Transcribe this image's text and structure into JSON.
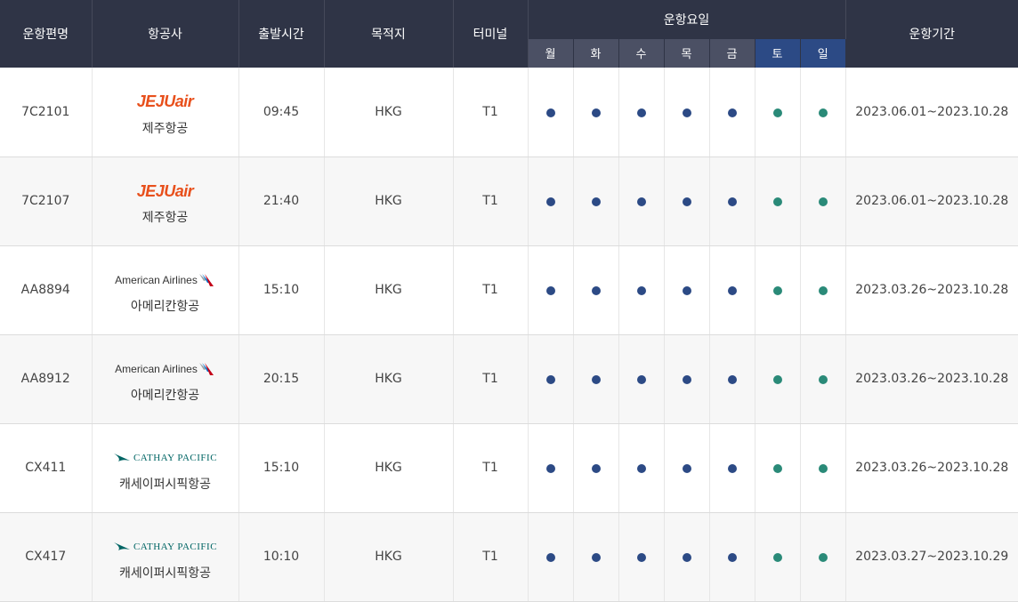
{
  "header": {
    "flight": "운항편명",
    "airline": "항공사",
    "departure": "출발시간",
    "destination": "목적지",
    "terminal": "터미널",
    "days_title": "운항요일",
    "days": [
      "월",
      "화",
      "수",
      "목",
      "금",
      "토",
      "일"
    ],
    "period": "운항기간"
  },
  "colors": {
    "header_bg": "#2f3446",
    "weekday_dot": "#2c4a85",
    "weekend_dot": "#2a8a78",
    "jeju_brand": "#e8501c"
  },
  "rows": [
    {
      "flight": "7C2101",
      "logo": "JEJUair",
      "logo_type": "jeju",
      "airline": "제주항공",
      "time": "09:45",
      "dest": "HKG",
      "terminal": "T1",
      "period": "2023.06.01~2023.10.28"
    },
    {
      "flight": "7C2107",
      "logo": "JEJUair",
      "logo_type": "jeju",
      "airline": "제주항공",
      "time": "21:40",
      "dest": "HKG",
      "terminal": "T1",
      "period": "2023.06.01~2023.10.28"
    },
    {
      "flight": "AA8894",
      "logo": "American Airlines",
      "logo_type": "aa",
      "airline": "아메리칸항공",
      "time": "15:10",
      "dest": "HKG",
      "terminal": "T1",
      "period": "2023.03.26~2023.10.28"
    },
    {
      "flight": "AA8912",
      "logo": "American Airlines",
      "logo_type": "aa",
      "airline": "아메리칸항공",
      "time": "20:15",
      "dest": "HKG",
      "terminal": "T1",
      "period": "2023.03.26~2023.10.28"
    },
    {
      "flight": "CX411",
      "logo": "CATHAY PACIFIC",
      "logo_type": "cx",
      "airline": "캐세이퍼시픽항공",
      "time": "15:10",
      "dest": "HKG",
      "terminal": "T1",
      "period": "2023.03.26~2023.10.28"
    },
    {
      "flight": "CX417",
      "logo": "CATHAY PACIFIC",
      "logo_type": "cx",
      "airline": "캐세이퍼시픽항공",
      "time": "10:10",
      "dest": "HKG",
      "terminal": "T1",
      "period": "2023.03.27~2023.10.29"
    }
  ]
}
